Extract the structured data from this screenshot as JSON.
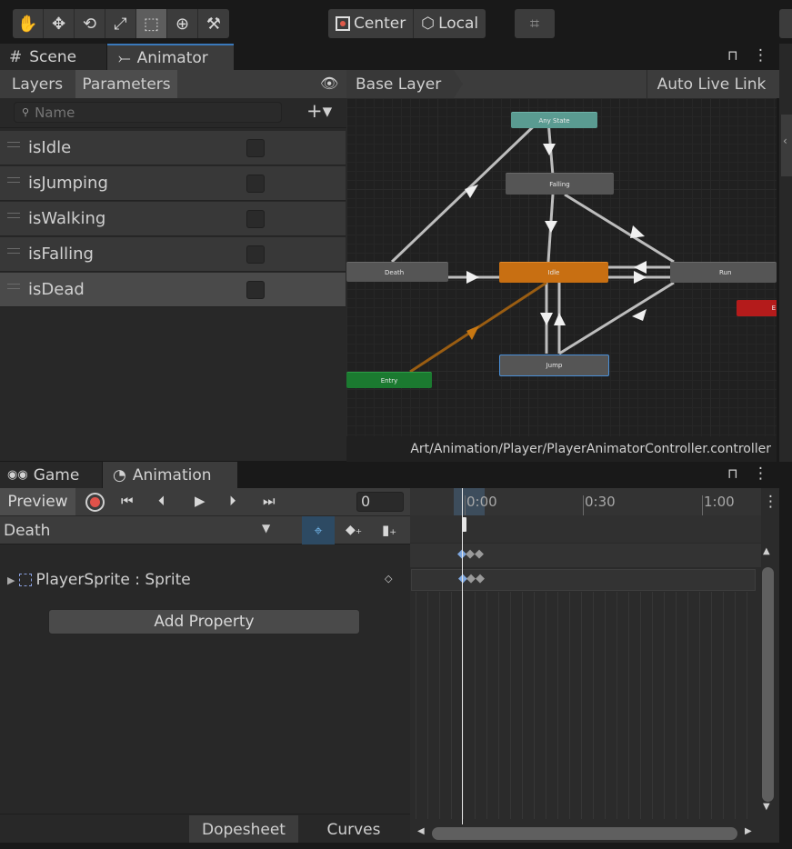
{
  "toolbar": {
    "tools": [
      {
        "icon": "hand-icon",
        "glyph": "✋"
      },
      {
        "icon": "move-icon",
        "glyph": "✥"
      },
      {
        "icon": "rotate-icon",
        "glyph": "⟲"
      },
      {
        "icon": "scale-icon",
        "glyph": "⤢"
      },
      {
        "icon": "rect-icon",
        "glyph": "⬚"
      },
      {
        "icon": "transform-icon",
        "glyph": "⊕"
      },
      {
        "icon": "custom-tools-icon",
        "glyph": "⚒"
      }
    ],
    "pivot_label": "Center",
    "space_label": "Local"
  },
  "top_panel": {
    "tabs": [
      {
        "label": "Scene",
        "icon": "hash-icon",
        "glyph": "#"
      },
      {
        "label": "Animator",
        "icon": "animator-icon",
        "glyph": "⤚"
      }
    ],
    "lock_glyph": "🔓",
    "menu_glyph": "⋮"
  },
  "animator": {
    "subtabs": [
      "Layers",
      "Parameters"
    ],
    "search_placeholder": "Name",
    "add_label": "+▾",
    "parameters": [
      {
        "name": "isIdle",
        "checked": false
      },
      {
        "name": "isJumping",
        "checked": false
      },
      {
        "name": "isWalking",
        "checked": false
      },
      {
        "name": "isFalling",
        "checked": false
      },
      {
        "name": "isDead",
        "checked": false
      }
    ],
    "breadcrumb": "Base Layer",
    "auto_live_link": "Auto Live Link",
    "states": {
      "any_state": "Any State",
      "falling": "Falling",
      "death": "Death",
      "idle": "Idle",
      "run": "Run",
      "jump": "Jump",
      "entry": "Entry",
      "exit": "E"
    },
    "controller_path": "Art/Animation/Player/PlayerAnimatorController.controller",
    "colors": {
      "any": "#5a9b91",
      "default": "#c86f12",
      "entry": "#1b7a30",
      "exit": "#b41b1b",
      "state": "#5a5a5a"
    }
  },
  "bottom_panel": {
    "tabs": [
      {
        "label": "Game",
        "icon": "gamepad-icon",
        "glyph": "🎮"
      },
      {
        "label": "Animation",
        "icon": "clock-icon",
        "glyph": "🕓"
      }
    ]
  },
  "animation": {
    "preview_label": "Preview",
    "frame_value": "0",
    "clip_name": "Death",
    "property": "PlayerSprite : Sprite",
    "add_property": "Add Property",
    "timeline_ticks": [
      "0:00",
      "0:30",
      "1:00"
    ],
    "mode_tabs": [
      "Dopesheet",
      "Curves"
    ]
  }
}
